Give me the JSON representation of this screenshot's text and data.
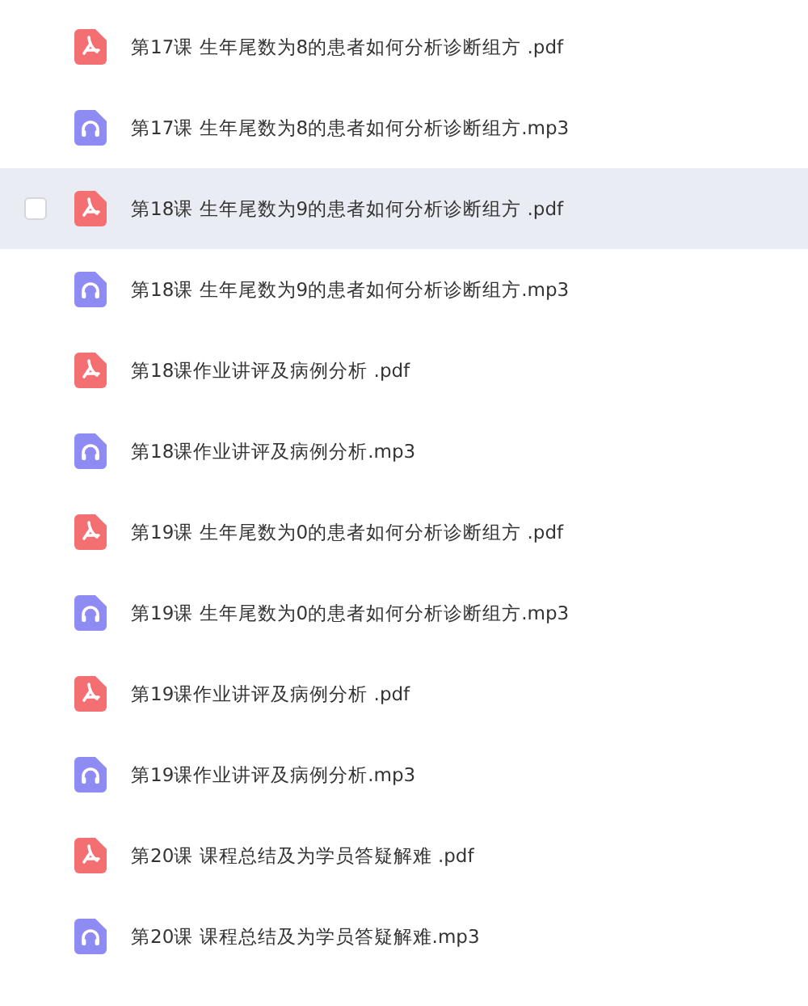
{
  "files": [
    {
      "name": "第17课 生年尾数为8的患者如何分析诊断组方 .pdf",
      "kind": "pdf",
      "highlighted": false
    },
    {
      "name": "第17课 生年尾数为8的患者如何分析诊断组方.mp3",
      "kind": "audio",
      "highlighted": false
    },
    {
      "name": "第18课 生年尾数为9的患者如何分析诊断组方 .pdf",
      "kind": "pdf",
      "highlighted": true
    },
    {
      "name": "第18课 生年尾数为9的患者如何分析诊断组方.mp3",
      "kind": "audio",
      "highlighted": false
    },
    {
      "name": "第18课作业讲评及病例分析 .pdf",
      "kind": "pdf",
      "highlighted": false
    },
    {
      "name": "第18课作业讲评及病例分析.mp3",
      "kind": "audio",
      "highlighted": false
    },
    {
      "name": "第19课 生年尾数为0的患者如何分析诊断组方 .pdf",
      "kind": "pdf",
      "highlighted": false
    },
    {
      "name": "第19课 生年尾数为0的患者如何分析诊断组方.mp3",
      "kind": "audio",
      "highlighted": false
    },
    {
      "name": "第19课作业讲评及病例分析 .pdf",
      "kind": "pdf",
      "highlighted": false
    },
    {
      "name": "第19课作业讲评及病例分析.mp3",
      "kind": "audio",
      "highlighted": false
    },
    {
      "name": "第20课 课程总结及为学员答疑解难 .pdf",
      "kind": "pdf",
      "highlighted": false
    },
    {
      "name": "第20课 课程总结及为学员答疑解难.mp3",
      "kind": "audio",
      "highlighted": false
    }
  ]
}
